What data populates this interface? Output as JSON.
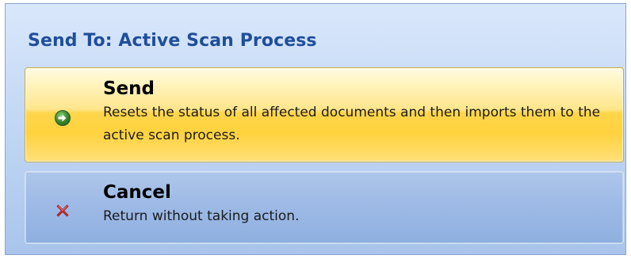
{
  "dialog": {
    "title": "Send To: Active Scan Process"
  },
  "commands": {
    "send": {
      "label": "Send",
      "description": "Resets the status of all affected documents and then imports them to the active scan process.",
      "icon": "green-arrow-right-icon"
    },
    "cancel": {
      "label": "Cancel",
      "description": "Return without taking action.",
      "icon": "red-x-icon"
    }
  },
  "colors": {
    "title": "#1f4e9c",
    "send_highlight": "#ffd54a",
    "cancel_background": "#a0bbe6",
    "send_icon": "#3f8f2f",
    "cancel_icon": "#d83030"
  }
}
